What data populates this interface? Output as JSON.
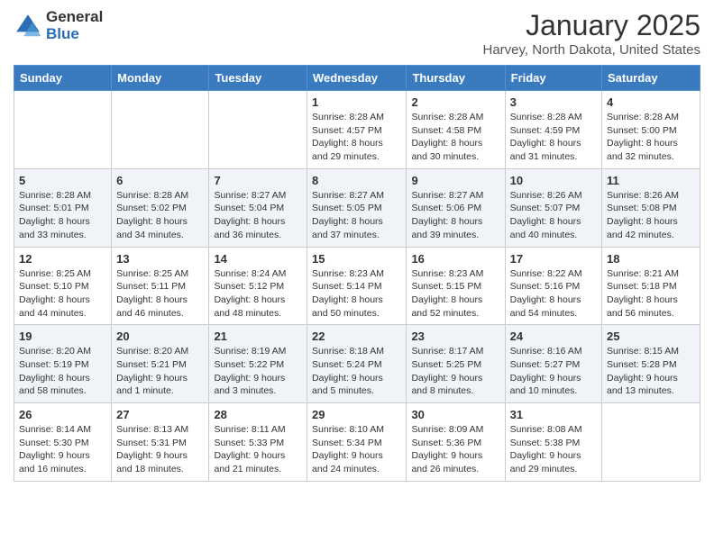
{
  "header": {
    "logo_general": "General",
    "logo_blue": "Blue",
    "month_title": "January 2025",
    "location": "Harvey, North Dakota, United States"
  },
  "days_of_week": [
    "Sunday",
    "Monday",
    "Tuesday",
    "Wednesday",
    "Thursday",
    "Friday",
    "Saturday"
  ],
  "weeks": [
    [
      {
        "day": "",
        "info": ""
      },
      {
        "day": "",
        "info": ""
      },
      {
        "day": "",
        "info": ""
      },
      {
        "day": "1",
        "info": "Sunrise: 8:28 AM\nSunset: 4:57 PM\nDaylight: 8 hours\nand 29 minutes."
      },
      {
        "day": "2",
        "info": "Sunrise: 8:28 AM\nSunset: 4:58 PM\nDaylight: 8 hours\nand 30 minutes."
      },
      {
        "day": "3",
        "info": "Sunrise: 8:28 AM\nSunset: 4:59 PM\nDaylight: 8 hours\nand 31 minutes."
      },
      {
        "day": "4",
        "info": "Sunrise: 8:28 AM\nSunset: 5:00 PM\nDaylight: 8 hours\nand 32 minutes."
      }
    ],
    [
      {
        "day": "5",
        "info": "Sunrise: 8:28 AM\nSunset: 5:01 PM\nDaylight: 8 hours\nand 33 minutes."
      },
      {
        "day": "6",
        "info": "Sunrise: 8:28 AM\nSunset: 5:02 PM\nDaylight: 8 hours\nand 34 minutes."
      },
      {
        "day": "7",
        "info": "Sunrise: 8:27 AM\nSunset: 5:04 PM\nDaylight: 8 hours\nand 36 minutes."
      },
      {
        "day": "8",
        "info": "Sunrise: 8:27 AM\nSunset: 5:05 PM\nDaylight: 8 hours\nand 37 minutes."
      },
      {
        "day": "9",
        "info": "Sunrise: 8:27 AM\nSunset: 5:06 PM\nDaylight: 8 hours\nand 39 minutes."
      },
      {
        "day": "10",
        "info": "Sunrise: 8:26 AM\nSunset: 5:07 PM\nDaylight: 8 hours\nand 40 minutes."
      },
      {
        "day": "11",
        "info": "Sunrise: 8:26 AM\nSunset: 5:08 PM\nDaylight: 8 hours\nand 42 minutes."
      }
    ],
    [
      {
        "day": "12",
        "info": "Sunrise: 8:25 AM\nSunset: 5:10 PM\nDaylight: 8 hours\nand 44 minutes."
      },
      {
        "day": "13",
        "info": "Sunrise: 8:25 AM\nSunset: 5:11 PM\nDaylight: 8 hours\nand 46 minutes."
      },
      {
        "day": "14",
        "info": "Sunrise: 8:24 AM\nSunset: 5:12 PM\nDaylight: 8 hours\nand 48 minutes."
      },
      {
        "day": "15",
        "info": "Sunrise: 8:23 AM\nSunset: 5:14 PM\nDaylight: 8 hours\nand 50 minutes."
      },
      {
        "day": "16",
        "info": "Sunrise: 8:23 AM\nSunset: 5:15 PM\nDaylight: 8 hours\nand 52 minutes."
      },
      {
        "day": "17",
        "info": "Sunrise: 8:22 AM\nSunset: 5:16 PM\nDaylight: 8 hours\nand 54 minutes."
      },
      {
        "day": "18",
        "info": "Sunrise: 8:21 AM\nSunset: 5:18 PM\nDaylight: 8 hours\nand 56 minutes."
      }
    ],
    [
      {
        "day": "19",
        "info": "Sunrise: 8:20 AM\nSunset: 5:19 PM\nDaylight: 8 hours\nand 58 minutes."
      },
      {
        "day": "20",
        "info": "Sunrise: 8:20 AM\nSunset: 5:21 PM\nDaylight: 9 hours\nand 1 minute."
      },
      {
        "day": "21",
        "info": "Sunrise: 8:19 AM\nSunset: 5:22 PM\nDaylight: 9 hours\nand 3 minutes."
      },
      {
        "day": "22",
        "info": "Sunrise: 8:18 AM\nSunset: 5:24 PM\nDaylight: 9 hours\nand 5 minutes."
      },
      {
        "day": "23",
        "info": "Sunrise: 8:17 AM\nSunset: 5:25 PM\nDaylight: 9 hours\nand 8 minutes."
      },
      {
        "day": "24",
        "info": "Sunrise: 8:16 AM\nSunset: 5:27 PM\nDaylight: 9 hours\nand 10 minutes."
      },
      {
        "day": "25",
        "info": "Sunrise: 8:15 AM\nSunset: 5:28 PM\nDaylight: 9 hours\nand 13 minutes."
      }
    ],
    [
      {
        "day": "26",
        "info": "Sunrise: 8:14 AM\nSunset: 5:30 PM\nDaylight: 9 hours\nand 16 minutes."
      },
      {
        "day": "27",
        "info": "Sunrise: 8:13 AM\nSunset: 5:31 PM\nDaylight: 9 hours\nand 18 minutes."
      },
      {
        "day": "28",
        "info": "Sunrise: 8:11 AM\nSunset: 5:33 PM\nDaylight: 9 hours\nand 21 minutes."
      },
      {
        "day": "29",
        "info": "Sunrise: 8:10 AM\nSunset: 5:34 PM\nDaylight: 9 hours\nand 24 minutes."
      },
      {
        "day": "30",
        "info": "Sunrise: 8:09 AM\nSunset: 5:36 PM\nDaylight: 9 hours\nand 26 minutes."
      },
      {
        "day": "31",
        "info": "Sunrise: 8:08 AM\nSunset: 5:38 PM\nDaylight: 9 hours\nand 29 minutes."
      },
      {
        "day": "",
        "info": ""
      }
    ]
  ]
}
